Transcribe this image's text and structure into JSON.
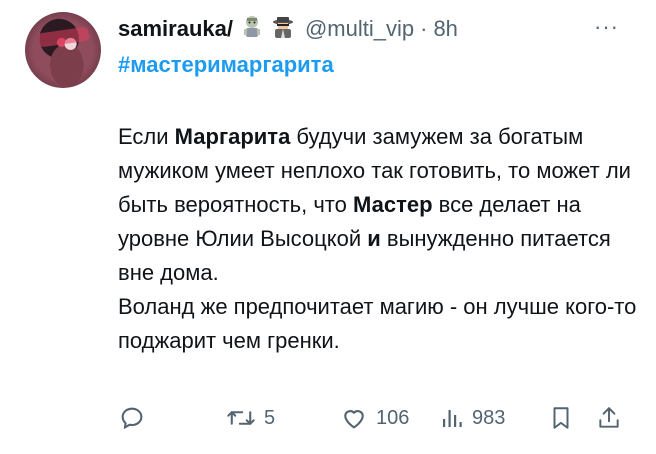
{
  "author": {
    "name": "samirauka/",
    "handle": "@multi_vip",
    "separator": "·",
    "time": "8h"
  },
  "hashtag": "#мастеримаргарита",
  "body": {
    "p1_s1": "Если ",
    "p1_b1": "Маргарита",
    "p1_s2": " будучи замужем за богатым мужиком умеет неплохо так готовить, то может ли быть вероятность, что ",
    "p1_b2": "Мастер",
    "p1_s3": " все делает на уровне Юлии Высоцкой ",
    "p1_b3": "и",
    "p1_s4": " вынужденно питается вне дома.",
    "p2": "Воланд же предпочитает магию - он лучше кого-то поджарит чем гренки."
  },
  "more_label": "···",
  "actions": {
    "retweets": "5",
    "likes": "106",
    "views": "983"
  },
  "icons": {
    "badge1": "zombie-emoji",
    "badge2": "spy-emoji",
    "reply": "reply-icon",
    "retweet": "retweet-icon",
    "like": "heart-icon",
    "views": "views-icon",
    "bookmark": "bookmark-icon",
    "share": "share-icon"
  }
}
